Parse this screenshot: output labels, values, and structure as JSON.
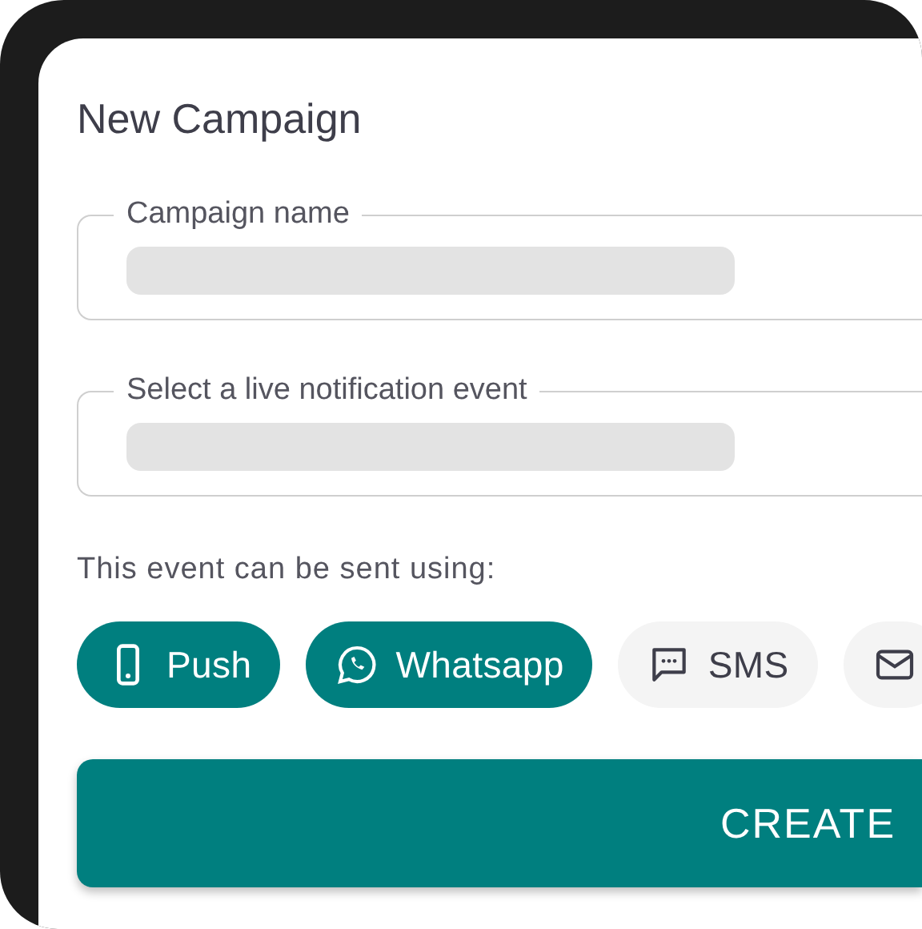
{
  "dialog": {
    "title": "New Campaign"
  },
  "fields": [
    {
      "label": "Campaign name",
      "loading": true
    },
    {
      "label": "Select a live notification event",
      "loading": true
    }
  ],
  "channels_prompt": "This event can be sent using:",
  "channels": [
    {
      "kind": "phone",
      "label": "Push",
      "selected": true
    },
    {
      "kind": "whatsapp",
      "label": "Whatsapp",
      "selected": true
    },
    {
      "kind": "chat",
      "label": "SMS",
      "selected": false
    },
    {
      "kind": "mail",
      "selected": false
    }
  ],
  "submit_button": {
    "label": "CREATE"
  }
}
